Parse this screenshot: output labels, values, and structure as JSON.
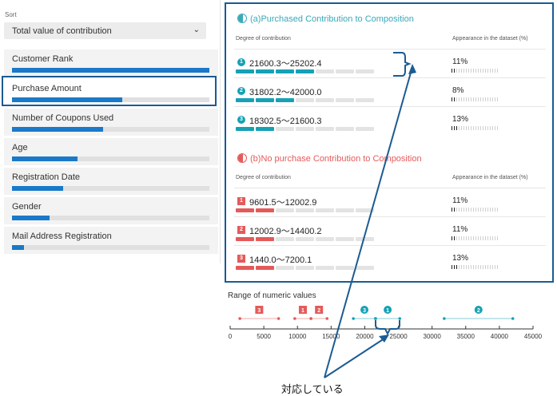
{
  "sidebar": {
    "sort_label": "Sort",
    "sort_value": "Total value of contribution",
    "factors": [
      {
        "label": "Customer Rank",
        "value": 1.0
      },
      {
        "label": "Purchase Amount",
        "value": 0.56
      },
      {
        "label": "Number of Coupons Used",
        "value": 0.46
      },
      {
        "label": "Age",
        "value": 0.33
      },
      {
        "label": "Registration Date",
        "value": 0.26
      },
      {
        "label": "Gender",
        "value": 0.19
      },
      {
        "label": "Mail Address Registration",
        "value": 0.06
      }
    ],
    "bar_color": "#1a79c8"
  },
  "purchased": {
    "title": "(a)Purchased Contribution to Composition",
    "color": "#3aa9b8",
    "bar_color": "#16a1b5",
    "col_degree": "Degree of contribution",
    "col_appearance": "Appearance in the dataset (%)",
    "rows": [
      {
        "badge": "1",
        "range": "21600.3～25202.4",
        "level": 4,
        "pct": "11%",
        "pct_value": 11
      },
      {
        "badge": "2",
        "range": "31802.2～42000.0",
        "level": 3,
        "pct": "8%",
        "pct_value": 8
      },
      {
        "badge": "3",
        "range": "18302.5～21600.3",
        "level": 2,
        "pct": "13%",
        "pct_value": 13
      }
    ]
  },
  "no_purchase": {
    "title": "(b)No purchase Contribution to Composition",
    "color": "#e45a5a",
    "bar_color": "#e45a5a",
    "col_degree": "Degree of contribution",
    "col_appearance": "Appearance in the dataset (%)",
    "rows": [
      {
        "badge": "1",
        "range": "9601.5～12002.9",
        "level": 2,
        "pct": "11%",
        "pct_value": 11
      },
      {
        "badge": "2",
        "range": "12002.9～14400.2",
        "level": 2,
        "pct": "11%",
        "pct_value": 11
      },
      {
        "badge": "3",
        "range": "1440.0～7200.1",
        "level": 2,
        "pct": "13%",
        "pct_value": 13
      }
    ]
  },
  "numeric_range": {
    "title": "Range of numeric values",
    "axis_min": 0,
    "axis_max": 45000,
    "ticks": [
      "0",
      "5000",
      "10000",
      "15000",
      "20000",
      "25000",
      "30000",
      "35000",
      "40000",
      "45000"
    ],
    "tick_values": [
      0,
      5000,
      10000,
      15000,
      20000,
      25000,
      30000,
      35000,
      40000,
      45000
    ],
    "intervals": [
      {
        "group": "no_purchase",
        "label": "3",
        "start": 1440.0,
        "end": 7200.1,
        "shape": "square"
      },
      {
        "group": "no_purchase",
        "label": "1",
        "start": 9601.5,
        "end": 12002.9,
        "shape": "square"
      },
      {
        "group": "no_purchase",
        "label": "2",
        "start": 12002.9,
        "end": 14400.2,
        "shape": "square"
      },
      {
        "group": "purchased",
        "label": "3",
        "start": 18302.5,
        "end": 21600.3,
        "shape": "circle"
      },
      {
        "group": "purchased",
        "label": "1",
        "start": 21600.3,
        "end": 25202.4,
        "shape": "circle"
      },
      {
        "group": "purchased",
        "label": "2",
        "start": 31802.2,
        "end": 42000.0,
        "shape": "circle"
      }
    ]
  },
  "annotation": {
    "text": "対応している",
    "color": "#1b5b93"
  }
}
